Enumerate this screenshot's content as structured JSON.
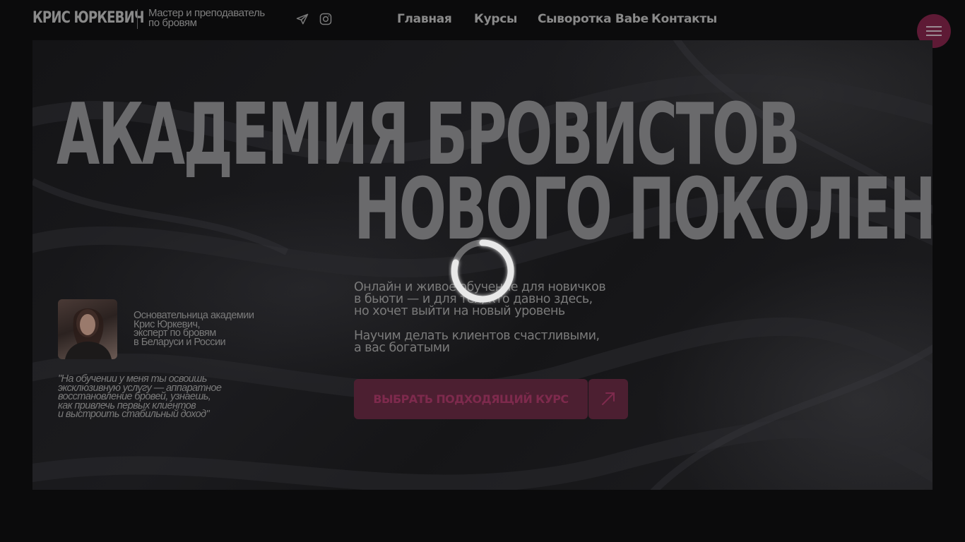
{
  "header": {
    "logo": "КРИС ЮРКЕВИЧ",
    "tagline_lines": [
      "Мастер и преподаватель",
      "по бровям"
    ]
  },
  "nav": {
    "items": [
      {
        "label": "Главная"
      },
      {
        "label": "Курсы"
      },
      {
        "label": "Сыворотка Babe"
      },
      {
        "label": "Контакты"
      }
    ]
  },
  "hero": {
    "title_line1": "АКАДЕМИЯ БРОВИСТОВ",
    "title_line2": "НОВОГО ПОКОЛЕНИЯ",
    "founder_lines": [
      "Основательница академии",
      "Крис Юркевич,",
      "эксперт по бровям",
      "в Беларуси и России"
    ],
    "quote_lines": [
      "\"На обучении у меня ты освоишь",
      "эксклюзивную услугу — аппаратное",
      "восстановление бровей, узнаешь,",
      "как привлечь первых клиентов",
      "и выстроить стабильный доход\""
    ],
    "description_lines": [
      "Онлайн и живое обучение для новичков",
      "в бьюти — и для тех, кто давно здесь,",
      "но хочет выйти на новый уровень"
    ],
    "description2_lines": [
      "Научим делать клиентов счастливыми,",
      "а вас богатыми"
    ],
    "cta_label": "ВЫБРАТЬ ПОДХОДЯЩИЙ КУРС"
  },
  "colors": {
    "background": "#0b0b0c",
    "accent": "#5e1a35",
    "cta": "#4c1f31",
    "cta_text": "#7e2a4d",
    "text_muted": "#7a7a7a"
  },
  "icons": {
    "telegram": "telegram-icon",
    "instagram": "instagram-icon",
    "menu": "hamburger-icon",
    "arrow": "arrow-up-right-icon",
    "loader": "loading-spinner-icon"
  }
}
